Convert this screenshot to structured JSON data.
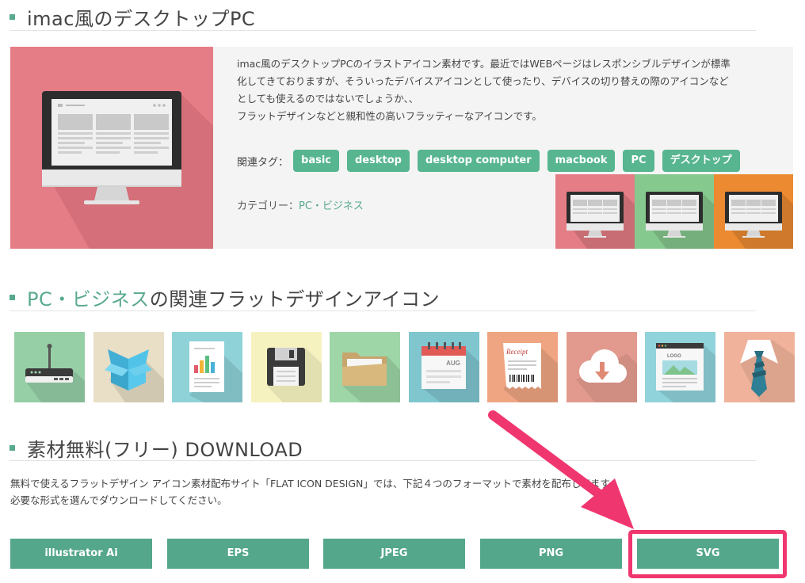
{
  "section1": {
    "title": "imac風のデスクトップPC",
    "description": [
      "imac風のデスクトップPCのイラストアイコン素材です。最近ではWEBページはレスポンシブルデザインが標準",
      "化してきておりますが、そういったデバイスアイコンとして使ったり、デバイスの切り替えの際のアイコンなど",
      "としても使えるのではないでしょうか、、",
      "フラットデザインなどと親和性の高いフラッティーなアイコンです。"
    ],
    "tags_label": "関連タグ：",
    "tags": [
      "basic",
      "desktop",
      "desktop computer",
      "macbook",
      "PC",
      "デスクトップ"
    ],
    "category_label": "カテゴリー：",
    "category_link": "PC・ビジネス",
    "hero_color": "#e57d86",
    "variants": [
      {
        "name": "pink",
        "color": "#e57d86"
      },
      {
        "name": "green",
        "color": "#86c98e"
      },
      {
        "name": "orange",
        "color": "#eb8a31"
      }
    ]
  },
  "section2": {
    "title_link": "PC・ビジネス",
    "title_rest": "の関連フラットデザインアイコン",
    "icons": [
      {
        "name": "router-icon",
        "bg": "#96cfa6"
      },
      {
        "name": "box-icon",
        "bg": "#e8dfc6"
      },
      {
        "name": "document-chart-icon",
        "bg": "#8fd3d9"
      },
      {
        "name": "floppy-disk-icon",
        "bg": "#f6f2c0"
      },
      {
        "name": "folder-icon",
        "bg": "#9fd6a8"
      },
      {
        "name": "calendar-icon",
        "bg": "#7fc6cf",
        "text": "AUG"
      },
      {
        "name": "receipt-icon",
        "bg": "#f0a582",
        "text": "Receipt"
      },
      {
        "name": "cloud-download-icon",
        "bg": "#e29a8e"
      },
      {
        "name": "web-browser-icon",
        "bg": "#90d3db",
        "text": "LOGO"
      },
      {
        "name": "shirt-tie-icon",
        "bg": "#f0b29a"
      }
    ]
  },
  "section3": {
    "title": "素材無料(フリー) DOWNLOAD",
    "text_line1": "無料で使えるフラットデザイン アイコン素材配布サイト「FLAT ICON DESIGN」では、下記４つのフォーマットで素材を配布してます。",
    "text_line2": "必要な形式を選んでダウンロードしてください。",
    "buttons": [
      "illustrator Ai",
      "EPS",
      "JPEG",
      "PNG",
      "SVG"
    ],
    "accent_color": "#f0366f"
  }
}
